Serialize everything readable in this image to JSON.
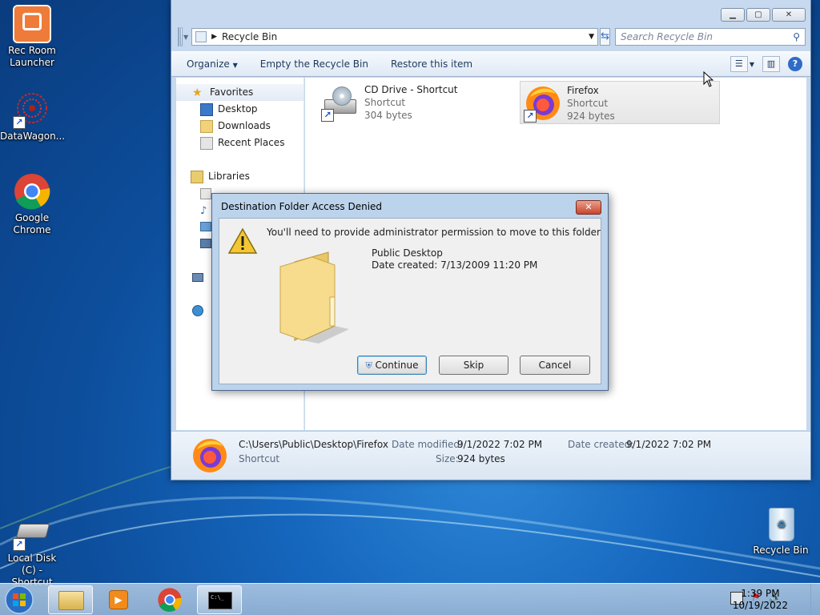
{
  "desktop": {
    "icons": [
      {
        "label": "Rec Room Launcher"
      },
      {
        "label": "DataWagon..."
      },
      {
        "label": "Google Chrome"
      },
      {
        "label": "Local Disk (C) - Shortcut"
      },
      {
        "label": "Recycle Bin"
      }
    ]
  },
  "explorer": {
    "address": {
      "location": "Recycle Bin"
    },
    "search": {
      "placeholder": "Search Recycle Bin"
    },
    "toolbar": {
      "organize": "Organize",
      "empty": "Empty the Recycle Bin",
      "restore": "Restore this item"
    },
    "nav": {
      "favorites": "Favorites",
      "desktop": "Desktop",
      "downloads": "Downloads",
      "recent": "Recent Places",
      "libraries": "Libraries"
    },
    "items": [
      {
        "name": "CD Drive - Shortcut",
        "type": "Shortcut",
        "size": "304 bytes"
      },
      {
        "name": "Firefox",
        "type": "Shortcut",
        "size": "924 bytes"
      }
    ],
    "details": {
      "path": "C:\\Users\\Public\\Desktop\\Firefox",
      "type": "Shortcut",
      "date_modified_label": "Date modified:",
      "date_modified": "9/1/2022 7:02 PM",
      "date_created_label": "Date created:",
      "date_created": "9/1/2022 7:02 PM",
      "size_label": "Size:",
      "size": "924 bytes"
    }
  },
  "dialog": {
    "title": "Destination Folder Access Denied",
    "message": "You'll need to provide administrator permission to move to this folder",
    "folder_name": "Public Desktop",
    "date_created": "Date created: 7/13/2009 11:20 PM",
    "buttons": {
      "continue": "Continue",
      "skip": "Skip",
      "cancel": "Cancel"
    }
  },
  "taskbar": {
    "time": "1:39 PM",
    "date": "10/19/2022"
  }
}
